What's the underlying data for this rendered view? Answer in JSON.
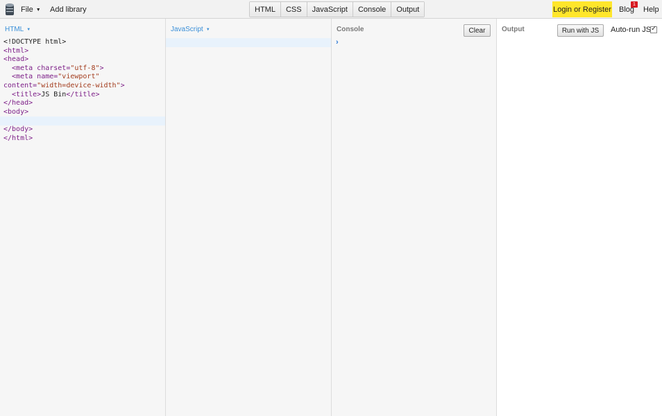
{
  "topbar": {
    "file_label": "File",
    "add_library_label": "Add library",
    "panel_tabs": [
      {
        "label": "HTML"
      },
      {
        "label": "CSS"
      },
      {
        "label": "JavaScript"
      },
      {
        "label": "Output"
      },
      {
        "label": "Console"
      }
    ],
    "login_label": "Login or Register",
    "blog_label": "Blog",
    "blog_badge": "1",
    "help_label": "Help",
    "login_bg_color": "#ffe62b",
    "badge_color": "#d71920"
  },
  "html_pane": {
    "label": "HTML",
    "code": {
      "l1": "<!DOCTYPE html>",
      "l2": "<html>",
      "l3": "<head>",
      "l4a": "  <meta ",
      "l4b": "charset=",
      "l4c": "\"utf-8\"",
      "l4d": ">",
      "l5a": "  <meta ",
      "l5b": "name=",
      "l5c": "\"viewport\"",
      "l6a": "content=",
      "l6b": "\"width=device-width\"",
      "l6c": ">",
      "l7a": "  <title>",
      "l7b": "JS Bin",
      "l7c": "</title>",
      "l8": "</head>",
      "l9": "<body>",
      "l10": "",
      "l11": "</body>",
      "l12": "</html>"
    }
  },
  "js_pane": {
    "label": "JavaScript"
  },
  "console_pane": {
    "title": "Console",
    "clear_label": "Clear",
    "prompt": "›"
  },
  "output_pane": {
    "title": "Output",
    "run_label": "Run with JS",
    "autorun_label": "Auto-run JS"
  }
}
